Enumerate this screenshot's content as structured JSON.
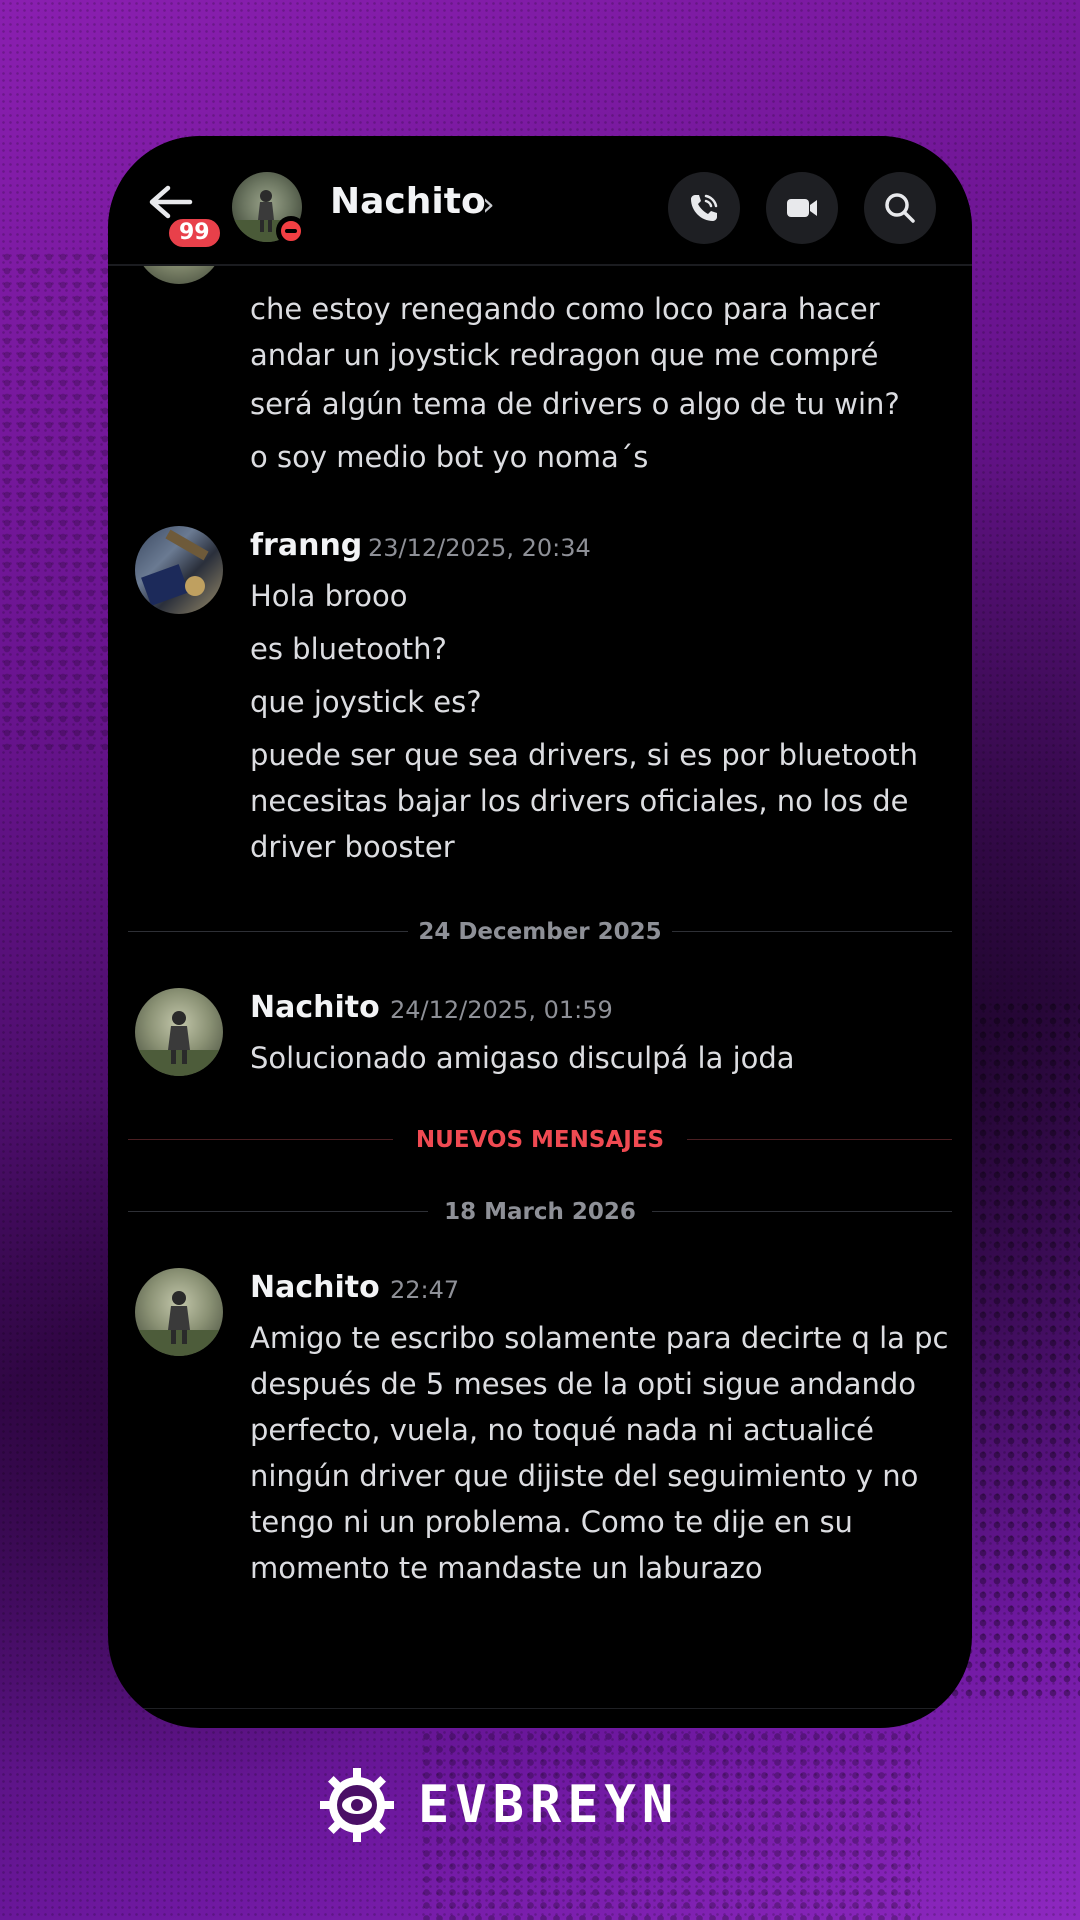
{
  "header": {
    "contact_name": "Nachito",
    "chevron": "›",
    "unread_badge": "99",
    "back_icon": "arrow-left-icon",
    "call_icon": "phone-call-icon",
    "video_icon": "video-camera-icon",
    "search_icon": "search-icon",
    "status": "do-not-disturb"
  },
  "messages": [
    {
      "author": "",
      "timestamp": "",
      "lines": [
        "che estoy renegando como loco para hacer andar un joystick redragon que me compré",
        "será algún tema de drivers o algo de tu win?",
        "o soy medio bot yo noma´s"
      ]
    },
    {
      "author": "franng",
      "timestamp": "23/12/2025, 20:34",
      "lines": [
        "Hola brooo",
        "es bluetooth?",
        "que joystick es?",
        "puede ser que sea drivers, si es por bluetooth necesitas bajar los drivers oficiales, no los de driver booster"
      ]
    },
    {
      "author": "Nachito",
      "timestamp": "24/12/2025, 01:59",
      "lines": [
        "Solucionado amigaso disculpá la joda"
      ]
    },
    {
      "author": "Nachito",
      "timestamp": "22:47",
      "lines": [
        "Amigo te escribo solamente para decirte q la pc después de 5 meses de la opti sigue andando perfecto, vuela, no toqué nada ni actualicé ningún driver que dijiste del seguimiento y no tengo ni un problema. Como te dije en su momento te mandaste un laburazo"
      ]
    }
  ],
  "dividers": {
    "date_1": "24 December 2025",
    "new_messages": "NUEVOS MENSAJES",
    "date_2": "18 March 2026"
  },
  "brand": {
    "name": "EVBREYN",
    "logo_icon": "eye-gear-logo-icon"
  },
  "colors": {
    "background": "#6a1490",
    "chat_bg": "#000000",
    "badge": "#e8404a",
    "new_messages": "#f04a52"
  }
}
